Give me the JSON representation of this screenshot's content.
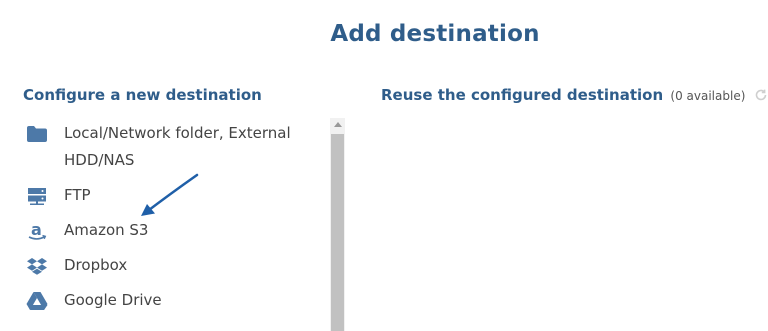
{
  "title": "Add destination",
  "configure": {
    "heading": "Configure a new destination",
    "items": [
      {
        "label": "Local/Network folder, External HDD/NAS",
        "icon": "folder-icon"
      },
      {
        "label": "FTP",
        "icon": "server-icon"
      },
      {
        "label": "Amazon S3",
        "icon": "amazon-icon"
      },
      {
        "label": "Dropbox",
        "icon": "dropbox-icon"
      },
      {
        "label": "Google Drive",
        "icon": "google-drive-icon"
      }
    ]
  },
  "reuse": {
    "heading": "Reuse the configured destination",
    "count_text": "(0 available)",
    "icon": "refresh-icon"
  },
  "colors": {
    "accent": "#2f5d8a",
    "icon": "#4d79a8",
    "annotation_arrow": "#1f5fa8"
  }
}
